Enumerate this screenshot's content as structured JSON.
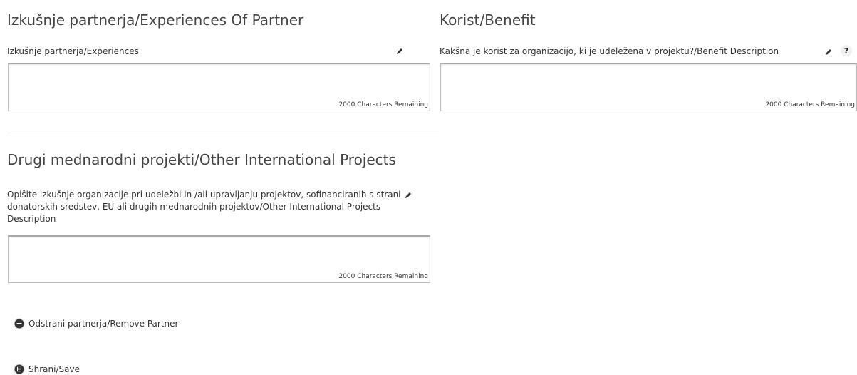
{
  "experiences": {
    "title": "Izkušnje partnerja/Experiences Of Partner",
    "field_label": "Izkušnje partnerja/Experiences",
    "counter": "2000 Characters Remaining",
    "value": ""
  },
  "benefit": {
    "title": "Korist/Benefit",
    "field_label": "Kakšna je korist za organizacijo, ki je udeležena v projektu?/Benefit Description",
    "help_label": "?",
    "counter": "2000 Characters Remaining",
    "value": ""
  },
  "international": {
    "title": "Drugi mednarodni projekti/Other International Projects",
    "field_label": "Opišite izkušnje organizacije pri udeležbi in /ali upravljanju projektov, sofinanciranih s strani donatorskih sredstev, EU ali drugih mednarodnih projektov/Other International Projects Description",
    "counter": "2000 Characters Remaining",
    "value": ""
  },
  "actions": {
    "remove_label": "Odstrani partnerja/Remove Partner",
    "save_label": "Shrani/Save"
  },
  "icons": {
    "edit": "pencil-icon",
    "remove": "minus-circle-icon",
    "save": "floppy-disk-icon",
    "help": "question-icon"
  }
}
